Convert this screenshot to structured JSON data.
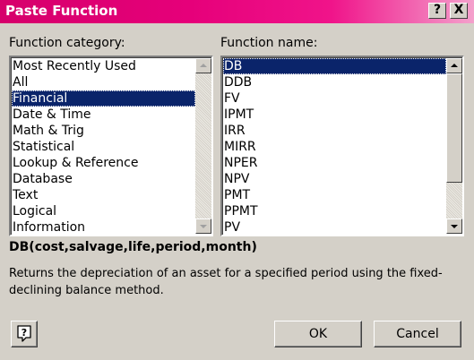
{
  "window": {
    "title": "Paste Function",
    "help_glyph": "?",
    "close_glyph": "X"
  },
  "category": {
    "label": "Function category:",
    "items": [
      "Most Recently Used",
      "All",
      "Financial",
      "Date & Time",
      "Math & Trig",
      "Statistical",
      "Lookup & Reference",
      "Database",
      "Text",
      "Logical",
      "Information"
    ],
    "selected": "Financial"
  },
  "functions": {
    "label": "Function name:",
    "items": [
      "DB",
      "DDB",
      "FV",
      "IPMT",
      "IRR",
      "MIRR",
      "NPER",
      "NPV",
      "PMT",
      "PPMT",
      "PV"
    ],
    "selected": "DB"
  },
  "syntax": "DB(cost,salvage,life,period,month)",
  "description": "Returns the depreciation of an asset for a specified period using the fixed-declining balance method.",
  "buttons": {
    "ok": "OK",
    "cancel": "Cancel"
  },
  "colors": {
    "title_bar": "#e6007a",
    "selection": "#0a246a",
    "dialog": "#d4d0c8"
  },
  "icons": {
    "help_button": "question-bubble-icon"
  }
}
